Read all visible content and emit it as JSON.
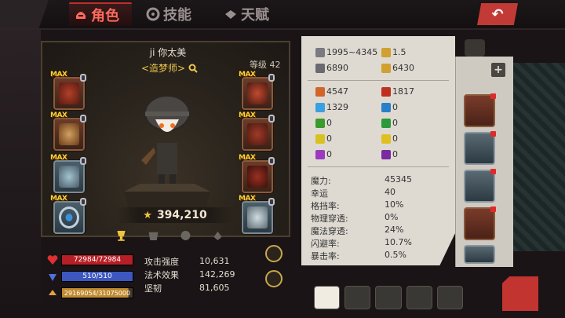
{
  "tabs": [
    {
      "label": "角色",
      "active": true
    },
    {
      "label": "技能",
      "active": false
    },
    {
      "label": "天赋",
      "active": false
    }
  ],
  "character": {
    "name": "ji 你太美",
    "title": "<造梦师>",
    "level_label": "等级 42",
    "power": "394,210"
  },
  "max_label": "MAX",
  "bars": {
    "hp": "72984/72984",
    "mp": "510/510",
    "xp": "29169054/31075000"
  },
  "core_stats": [
    {
      "label": "攻击强度",
      "value": "10,631"
    },
    {
      "label": "法术效果",
      "value": "142,269"
    },
    {
      "label": "坚韧",
      "value": "81,605"
    }
  ],
  "top_stats": [
    {
      "icon": "sword-icon",
      "value": "1995~4345"
    },
    {
      "icon": "speed-icon",
      "value": "1.5"
    },
    {
      "icon": "shield-icon",
      "value": "6890"
    },
    {
      "icon": "wand-icon",
      "value": "6430"
    }
  ],
  "elem_stats": [
    {
      "icon": "flame-orange-icon",
      "value": "4547",
      "color": "#d2642a"
    },
    {
      "icon": "flame-red-icon",
      "value": "1817",
      "color": "#c03020"
    },
    {
      "icon": "ice-icon",
      "value": "1329",
      "color": "#3aa0e0"
    },
    {
      "icon": "water-icon",
      "value": "0",
      "color": "#2a80c8"
    },
    {
      "icon": "poison-icon",
      "value": "0",
      "color": "#3a9a2a"
    },
    {
      "icon": "nature-icon",
      "value": "0",
      "color": "#2a9a3a"
    },
    {
      "icon": "lightning-icon",
      "value": "0",
      "color": "#d8c020"
    },
    {
      "icon": "sun-icon",
      "value": "0",
      "color": "#e0c020"
    },
    {
      "icon": "shadow-icon",
      "value": "0",
      "color": "#9a3ac0"
    },
    {
      "icon": "void-icon",
      "value": "0",
      "color": "#7a2aa0"
    }
  ],
  "detail_stats": [
    {
      "label": "魔力:",
      "value": "45345"
    },
    {
      "label": "幸运",
      "value": "40"
    },
    {
      "label": "格挡率:",
      "value": "10%"
    },
    {
      "label": "物理穿透:",
      "value": "0%"
    },
    {
      "label": "魔法穿透:",
      "value": "24%"
    },
    {
      "label": "闪避率:",
      "value": "10.7%"
    },
    {
      "label": "暴击率:",
      "value": "0.5%"
    }
  ],
  "colors": {
    "accent_red": "#c23a36",
    "gold": "#f0c340",
    "hp": "#b81e26",
    "mp": "#3c58c0"
  }
}
